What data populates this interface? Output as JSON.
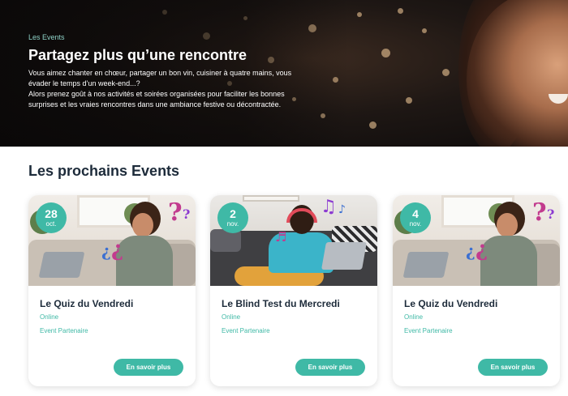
{
  "hero": {
    "kicker": "Les Events",
    "title": "Partagez plus qu’une rencontre",
    "paragraph_1": "Vous aimez chanter en chœur, partager un bon vin, cuisiner à quatre mains, vous évader le temps d’un week-end...?",
    "paragraph_2": "Alors prenez goût à nos activités et soirées organisées pour faciliter les bonnes surprises et les vraies rencontres dans une ambiance festive ou décontractée."
  },
  "section": {
    "title": "Les prochains Events"
  },
  "events": [
    {
      "day": "28",
      "month": "oct.",
      "title": "Le Quiz du Vendredi",
      "mode": "Online",
      "tag": "Event Partenaire",
      "cta": "En savoir plus",
      "image": "quiz-woman-laptop"
    },
    {
      "day": "2",
      "month": "nov.",
      "title": "Le Blind Test du Mercredi",
      "mode": "Online",
      "tag": "Event Partenaire",
      "cta": "En savoir plus",
      "image": "blind-test-woman-headphones"
    },
    {
      "day": "4",
      "month": "nov.",
      "title": "Le Quiz du Vendredi",
      "mode": "Online",
      "tag": "Event Partenaire",
      "cta": "En savoir plus",
      "image": "quiz-woman-laptop"
    }
  ],
  "colors": {
    "accent": "#3fb9a6",
    "heading": "#1d2b3a",
    "kicker": "#8fd3c8"
  }
}
